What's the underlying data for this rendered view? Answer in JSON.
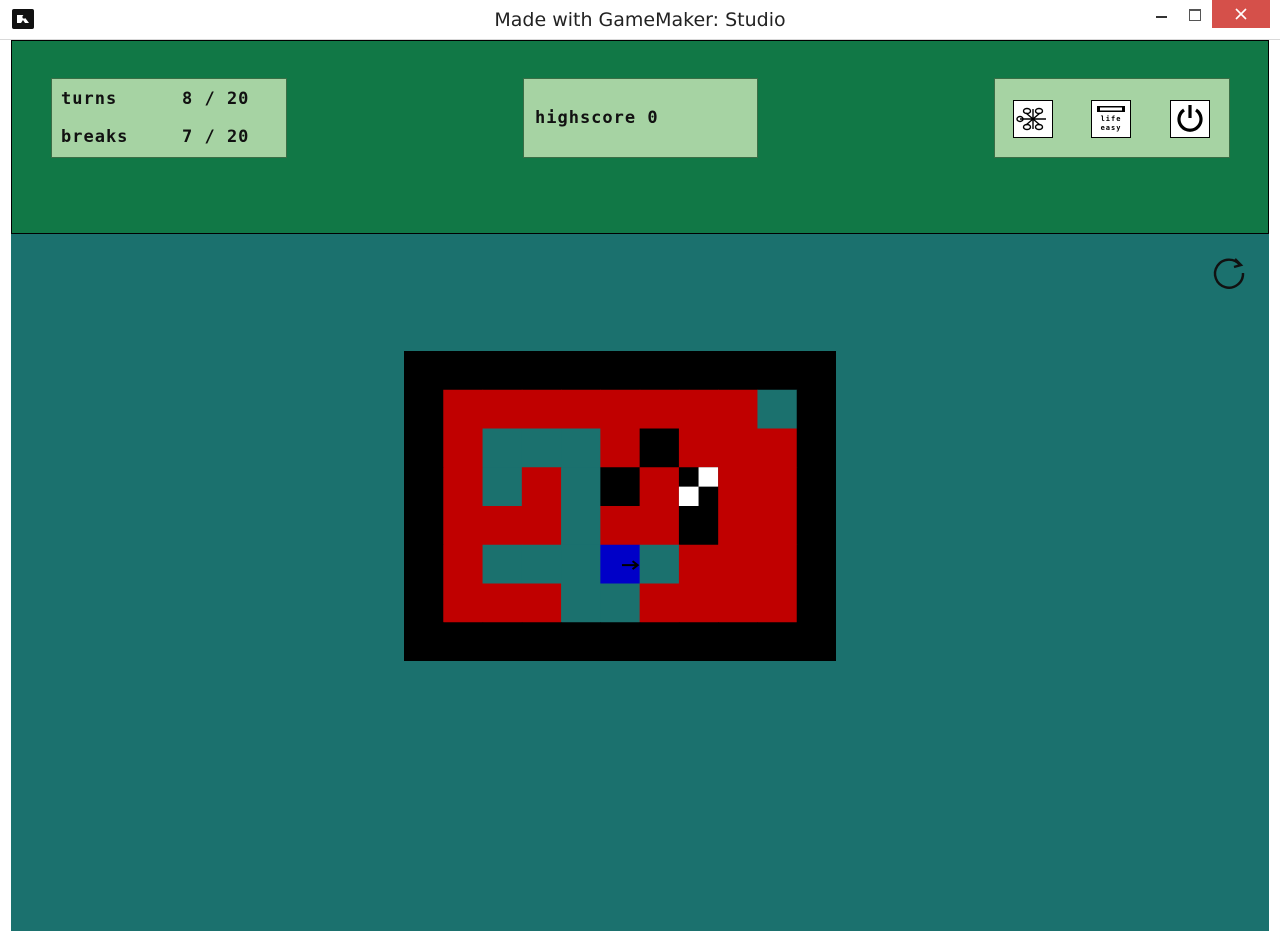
{
  "window": {
    "title": "Made with GameMaker: Studio"
  },
  "hud": {
    "turns_label": "turns",
    "turns_value": "8 / 20",
    "breaks_label": "breaks",
    "breaks_value": "7 / 20",
    "highscore_text": "highscore 0"
  },
  "toolbar": {
    "tools": [
      {
        "icon": "network-nodes-icon"
      },
      {
        "icon": "life-easy-icon",
        "text_top": "",
        "text_life": "life",
        "text_easy": "easy"
      },
      {
        "icon": "power-icon"
      }
    ],
    "restart_icon": "restart-icon"
  },
  "colors": {
    "game_bg": "#1b716e",
    "top_bar": "#117846",
    "panel": "#a6d3a3",
    "wall": "#000000",
    "lava": "#c00000",
    "floor": "#1b716e",
    "player": "#0000c8",
    "white_tile": "#ffffff"
  },
  "board": {
    "cols": 11,
    "rows": 8,
    "cells": [
      "WWWWWWWWWWW",
      "WRRRRRRRRFW",
      "WRFFFRBRRRW",
      "WRFRFBRXRRW",
      "WRRRFRRBRRW",
      "WRFFFPFRRRW",
      "WRRRFFRRRRW",
      "WWWWWWWWWWW"
    ],
    "legend": {
      "W": "wall",
      "R": "lava",
      "F": "floor",
      "B": "black-block",
      "P": "player",
      "X": "checker-tile"
    },
    "player_direction": "right"
  }
}
